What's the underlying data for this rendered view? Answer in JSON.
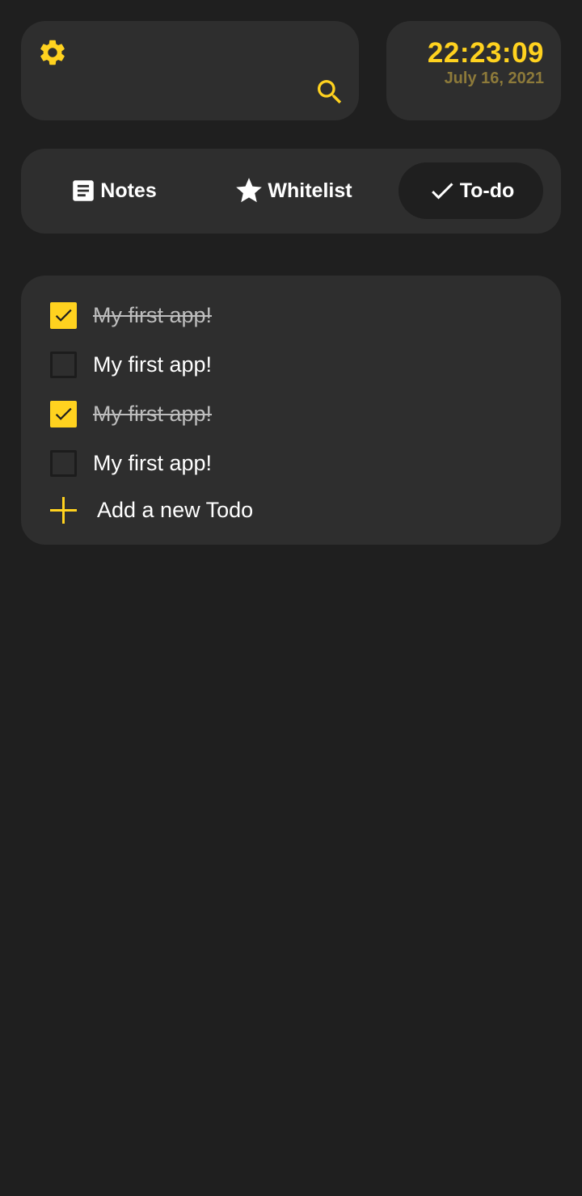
{
  "header": {
    "settings_icon": "gear-icon",
    "search_icon": "search-icon",
    "time": "22:23:09",
    "date": "July 16, 2021"
  },
  "tabs": [
    {
      "label": "Notes",
      "icon": "note-icon",
      "selected": false
    },
    {
      "label": "Whitelist",
      "icon": "star-icon",
      "selected": false
    },
    {
      "label": "To-do",
      "icon": "check-icon",
      "selected": true
    }
  ],
  "todos": [
    {
      "text": "My first app!",
      "done": true
    },
    {
      "text": "My first app!",
      "done": false
    },
    {
      "text": "My first app!",
      "done": true
    },
    {
      "text": "My first app!",
      "done": false
    }
  ],
  "add_todo": {
    "label": "Add a new Todo",
    "icon": "plus-icon"
  },
  "colors": {
    "accent": "#ffd21f",
    "date": "#8d7a3a",
    "background": "#1f1f1f",
    "card": "#2e2e2e"
  }
}
